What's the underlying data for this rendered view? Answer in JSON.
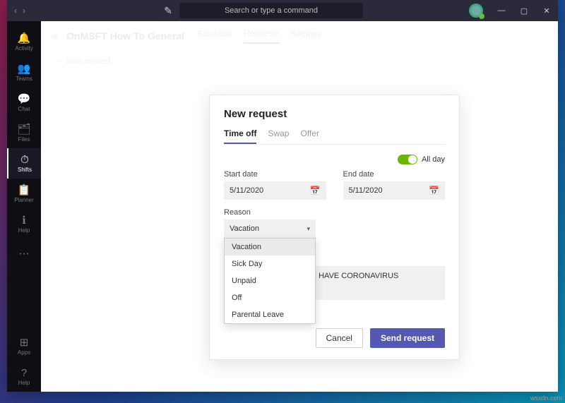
{
  "titlebar": {
    "back_icon": "‹",
    "forward_icon": "›",
    "compose_icon": "✎",
    "search_placeholder": "Search or type a command",
    "minimize": "—",
    "maximize": "▢",
    "close": "✕"
  },
  "sidebar": {
    "items": [
      {
        "icon": "🔔",
        "label": "Activity"
      },
      {
        "icon": "👥",
        "label": "Teams"
      },
      {
        "icon": "💬",
        "label": "Chat"
      },
      {
        "icon": "🗂",
        "label": "Files"
      },
      {
        "icon": "⏱",
        "label": "Shifts"
      },
      {
        "icon": "📋",
        "label": "Planner"
      },
      {
        "icon": "ℹ",
        "label": "Help"
      },
      {
        "icon": "⋯",
        "label": ""
      }
    ],
    "bottom": [
      {
        "icon": "⊞",
        "label": "Apps"
      },
      {
        "icon": "?",
        "label": "Help"
      }
    ]
  },
  "header": {
    "hamburger": "≡",
    "title": "OnMSFT How To General",
    "tabs": [
      "Schedule",
      "Requests",
      "Settings"
    ],
    "active_tab": 1,
    "new_request_plus": "+",
    "new_request_label": "New request"
  },
  "modal": {
    "title": "New request",
    "tabs": [
      "Time off",
      "Swap",
      "Offer"
    ],
    "active_tab": 0,
    "allday_label": "All day",
    "start_label": "Start date",
    "start_value": "5/11/2020",
    "end_label": "End date",
    "end_value": "5/11/2020",
    "reason_label": "Reason",
    "reason_value": "Vacation",
    "reason_options": [
      "Vacation",
      "Sick Day",
      "Unpaid",
      "Off",
      "Parental Leave"
    ],
    "note_value": "I HAVE CORONAVIRUS",
    "cancel_label": "Cancel",
    "send_label": "Send request"
  },
  "watermark": "wsxdn.com"
}
